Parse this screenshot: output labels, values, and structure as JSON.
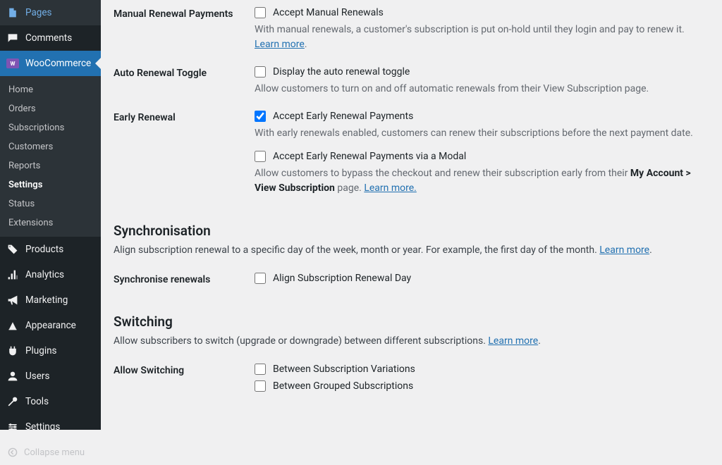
{
  "sidebar": {
    "top_items": [
      {
        "label": "Pages",
        "icon": "pages"
      },
      {
        "label": "Comments",
        "icon": "comments"
      },
      {
        "label": "WooCommerce",
        "icon": "woo",
        "active": true
      }
    ],
    "sub_items": [
      {
        "label": "Home"
      },
      {
        "label": "Orders"
      },
      {
        "label": "Subscriptions"
      },
      {
        "label": "Customers"
      },
      {
        "label": "Reports"
      },
      {
        "label": "Settings",
        "active": true
      },
      {
        "label": "Status"
      },
      {
        "label": "Extensions"
      }
    ],
    "bottom_items": [
      {
        "label": "Products",
        "icon": "products"
      },
      {
        "label": "Analytics",
        "icon": "analytics"
      },
      {
        "label": "Marketing",
        "icon": "marketing"
      },
      {
        "label": "Appearance",
        "icon": "appearance"
      },
      {
        "label": "Plugins",
        "icon": "plugins"
      },
      {
        "label": "Users",
        "icon": "users"
      },
      {
        "label": "Tools",
        "icon": "tools"
      },
      {
        "label": "Settings",
        "icon": "settings"
      }
    ],
    "collapse": "Collapse menu"
  },
  "settings": {
    "manual_renewal": {
      "heading": "Manual Renewal Payments",
      "checkbox_label": "Accept Manual Renewals",
      "description_part1": "With manual renewals, a customer's subscription is put on-hold until they login and pay to renew it. ",
      "learn_more": "Learn more",
      "period": "."
    },
    "auto_renewal": {
      "heading": "Auto Renewal Toggle",
      "checkbox_label": "Display the auto renewal toggle",
      "description": "Allow customers to turn on and off automatic renewals from their View Subscription page."
    },
    "early_renewal": {
      "heading": "Early Renewal",
      "checkbox1_label": "Accept Early Renewal Payments",
      "description1": "With early renewals enabled, customers can renew their subscriptions before the next payment date.",
      "checkbox2_label": "Accept Early Renewal Payments via a Modal",
      "description2_part1": "Allow customers to bypass the checkout and renew their subscription early from their ",
      "description2_strong": "My Account > View Subscription",
      "description2_part2": " page. ",
      "learn_more": "Learn more."
    },
    "sync": {
      "title": "Synchronisation",
      "desc": "Align subscription renewal to a specific day of the week, month or year. For example, the first day of the month. ",
      "learn_more": "Learn more",
      "period": ".",
      "row_heading": "Synchronise renewals",
      "checkbox_label": "Align Subscription Renewal Day"
    },
    "switching": {
      "title": "Switching",
      "desc": "Allow subscribers to switch (upgrade or downgrade) between different subscriptions. ",
      "learn_more": "Learn more",
      "period": ".",
      "row_heading": "Allow Switching",
      "checkbox1_label": "Between Subscription Variations",
      "checkbox2_label": "Between Grouped Subscriptions"
    }
  }
}
